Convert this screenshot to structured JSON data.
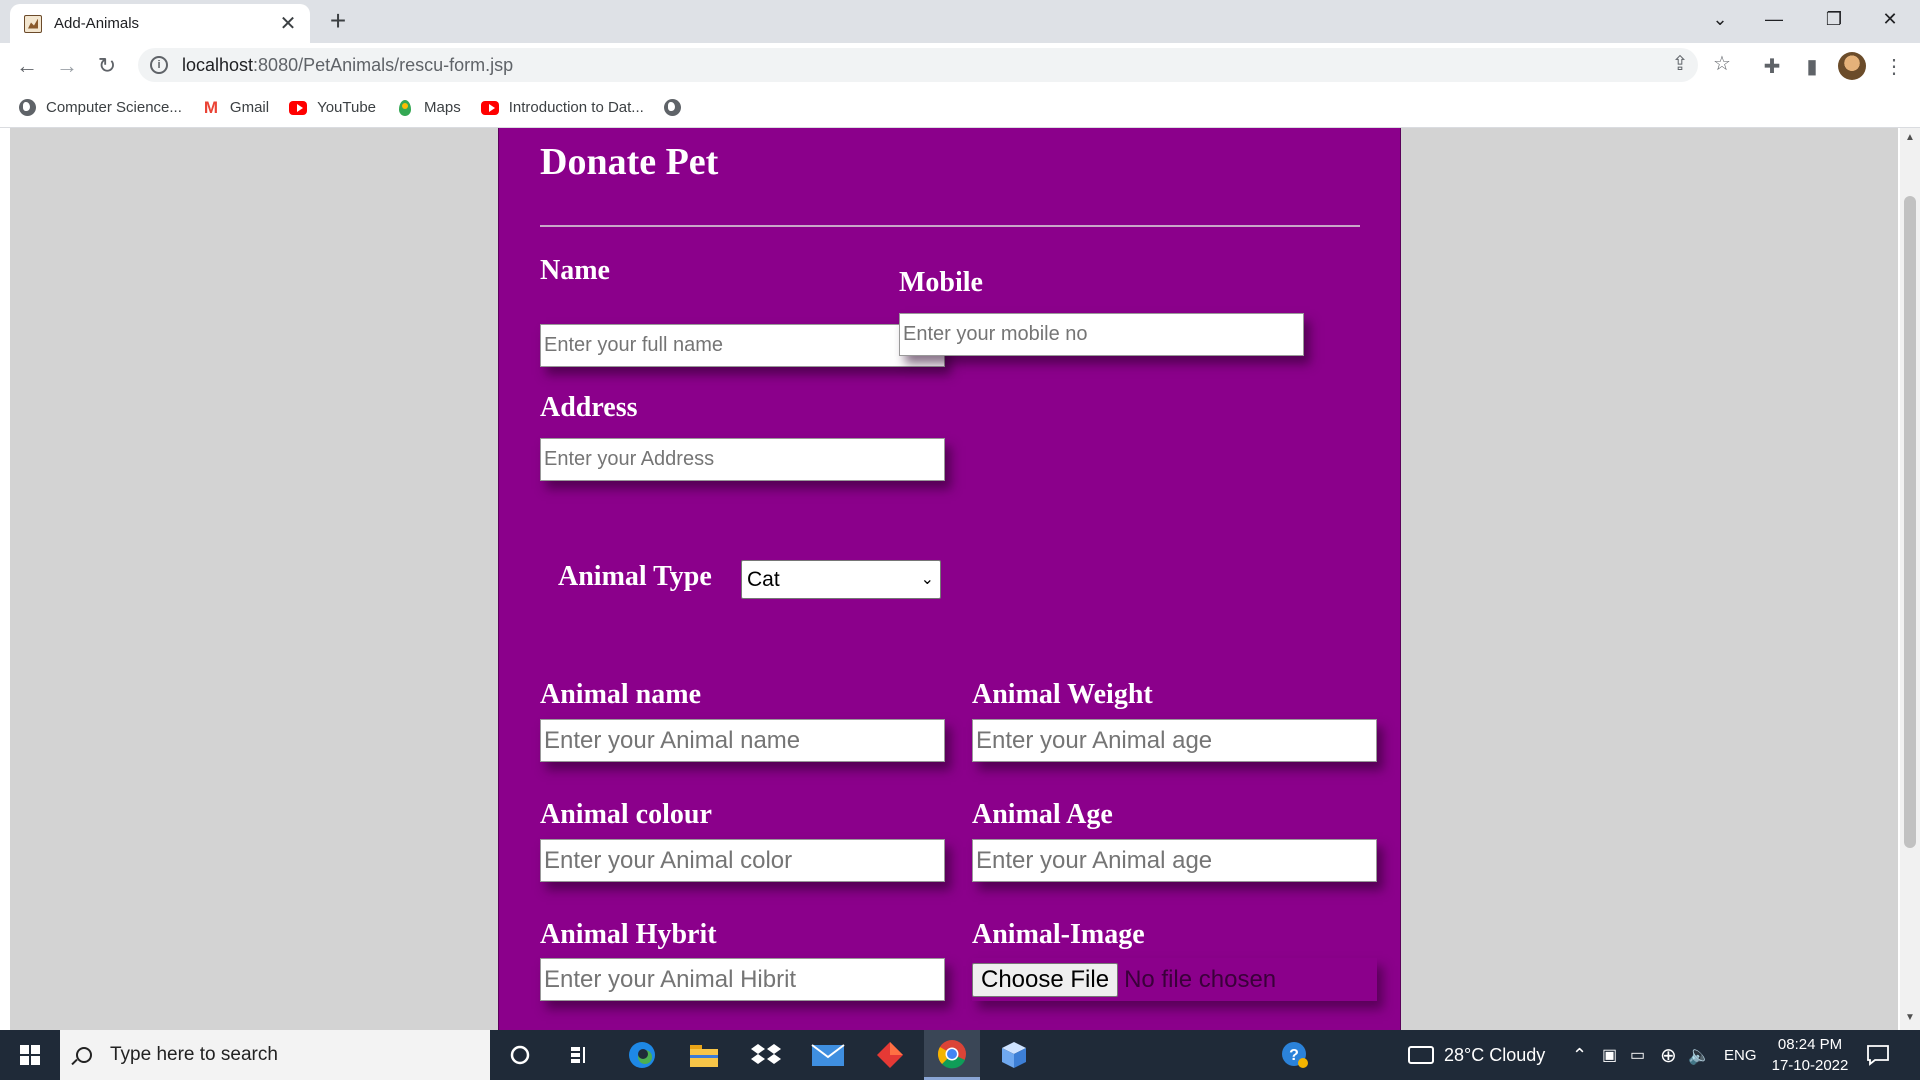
{
  "browser": {
    "tab_title": "Add-Animals",
    "url_host": "localhost",
    "url_path": ":8080/PetAnimals/rescu-form.jsp",
    "bookmarks": [
      {
        "label": "Computer Science...",
        "icon": "globe-icon"
      },
      {
        "label": "Gmail",
        "icon": "gmail-icon"
      },
      {
        "label": "YouTube",
        "icon": "youtube-icon"
      },
      {
        "label": "Maps",
        "icon": "maps-icon"
      },
      {
        "label": "Introduction to Dat...",
        "icon": "youtube-icon"
      }
    ]
  },
  "form": {
    "title": "Donate Pet",
    "name_label": "Name",
    "name_placeholder": "Enter your full name",
    "mobile_label": "Mobile",
    "mobile_placeholder": "Enter your mobile no",
    "address_label": "Address",
    "address_placeholder": "Enter your Address",
    "animal_type_label": "Animal Type",
    "animal_type_value": "Cat",
    "animal_name_label": "Animal name",
    "animal_name_placeholder": "Enter your Animal name",
    "animal_weight_label": "Animal Weight",
    "animal_weight_placeholder": "Enter your Animal age",
    "animal_colour_label": "Animal colour",
    "animal_colour_placeholder": "Enter your Animal color",
    "animal_age_label": "Animal Age",
    "animal_age_placeholder": "Enter your Animal age",
    "animal_hybrit_label": "Animal Hybrit",
    "animal_hybrit_placeholder": "Enter your Animal Hibrit",
    "animal_image_label": "Animal-Image",
    "file_button": "Choose File",
    "file_status": "No file chosen"
  },
  "colors": {
    "panel": "#8b008b",
    "page_bg": "#d3d3d3"
  },
  "taskbar": {
    "search_placeholder": "Type here to search",
    "weather": "28°C  Cloudy",
    "language": "ENG",
    "time": "08:24 PM",
    "date": "17-10-2022"
  }
}
